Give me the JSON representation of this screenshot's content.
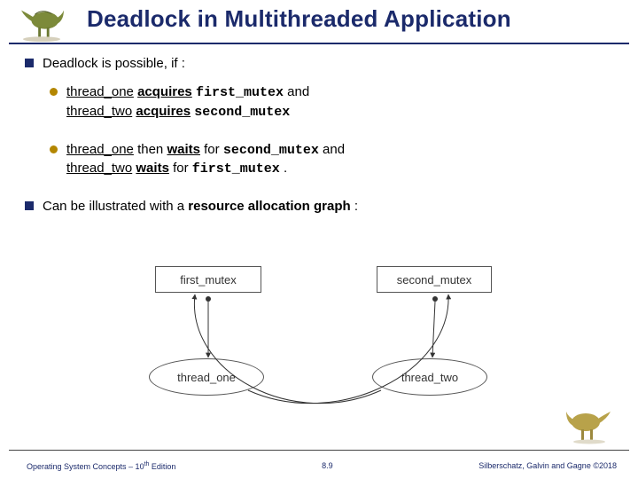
{
  "title": "Deadlock in Multithreaded Application",
  "bullets": {
    "b1": "Deadlock is possible, if :",
    "b1s1_t1": "thread_one",
    "b1s1_acq": "acquires",
    "b1s1_m1": "first_mutex",
    "b1s1_and": " and ",
    "b1s1_t2": "thread_two",
    "b1s1_acq2": "acquires",
    "b1s1_m2": "second_mutex",
    "b1s2_t1": "thread_one",
    "b1s2_then": " then ",
    "b1s2_waits": "waits",
    "b1s2_for": " for ",
    "b1s2_m2": "second_mutex",
    "b1s2_and": " and ",
    "b1s2_t2": "thread_two",
    "b1s2_waits2": "waits",
    "b1s2_for2": " for ",
    "b1s2_m1": "first_mutex",
    "b1s2_dot": ".",
    "b2_pre": "Can be illustrated with a ",
    "b2_bold": "resource allocation graph",
    "b2_post": ":"
  },
  "diagram": {
    "first_mutex": "first_mutex",
    "second_mutex": "second_mutex",
    "thread_one": "thread_one",
    "thread_two": "thread_two"
  },
  "footer": {
    "left_a": "Operating System Concepts – 10",
    "left_sup": "th",
    "left_b": " Edition",
    "center": "8.9",
    "right": "Silberschatz, Galvin and Gagne ©2018"
  }
}
